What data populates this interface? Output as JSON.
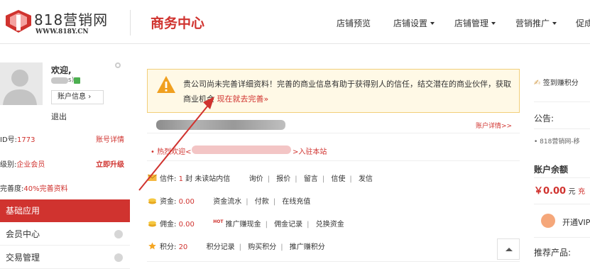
{
  "header": {
    "logo_text": "818营销网",
    "logo_url": "WWW.818Y.CN",
    "title": "商务中心",
    "nav": [
      {
        "label": "店铺预览",
        "dropdown": false
      },
      {
        "label": "店铺设置",
        "dropdown": true
      },
      {
        "label": "店铺管理",
        "dropdown": true
      },
      {
        "label": "营销推广",
        "dropdown": true
      },
      {
        "label": "促成",
        "dropdown": false
      }
    ]
  },
  "sidebar": {
    "welcome": "欢迎,",
    "user_suffix": "s)",
    "account_info_button": "账户信息",
    "logout": "退出",
    "id_label": "ID号:",
    "id_value": "1773",
    "id_link": "账号详情",
    "level_label": "级别:",
    "level_value": "企业会员",
    "level_link": "立即升级",
    "completeness_label": "完善度:",
    "completeness_value": "40%完善资料",
    "menu_active": "基础应用",
    "menu_items": [
      "会员中心",
      "交易管理"
    ]
  },
  "notice": {
    "text": "贵公司尚未完善详细资料！完善的商业信息有助于获得别人的信任，结交潜在的商业伙伴，获取商业机会",
    "link": "现在就去完善»"
  },
  "account": {
    "detail_link": "账户详情>>",
    "hot_welcome": "热烈欢迎<",
    "join_text": ">入驻本站"
  },
  "lines": {
    "letters": {
      "label": "信件:",
      "count": "1",
      "unit": "封 未读站内信",
      "links": [
        "询价",
        "报价",
        "留言",
        "信使",
        "发信"
      ]
    },
    "funds": {
      "label": "资金:",
      "value": "0.00",
      "links": [
        "资金流水",
        "付款",
        "在线充值"
      ]
    },
    "commission": {
      "label": "佣金:",
      "value": "0.00",
      "hot": "HOT",
      "links": [
        "推广赚现金",
        "佣金记录",
        "兑换资金"
      ]
    },
    "points": {
      "label": "积分:",
      "value": "20",
      "links": [
        "积分记录",
        "购买积分",
        "推广赚积分"
      ]
    }
  },
  "right": {
    "signin": "签到赚积分",
    "announce_title": "公告:",
    "announce_item": "818营销网-移",
    "balance_title": "账户余额",
    "balance_value": "￥0.00",
    "balance_unit": "元",
    "balance_more": "充",
    "vip": "开通VIP",
    "recommend": "推荐产品:"
  },
  "colors": {
    "accent": "#d0332f",
    "notice_bg": "#fff9e6",
    "notice_border": "#f2cf7a"
  }
}
